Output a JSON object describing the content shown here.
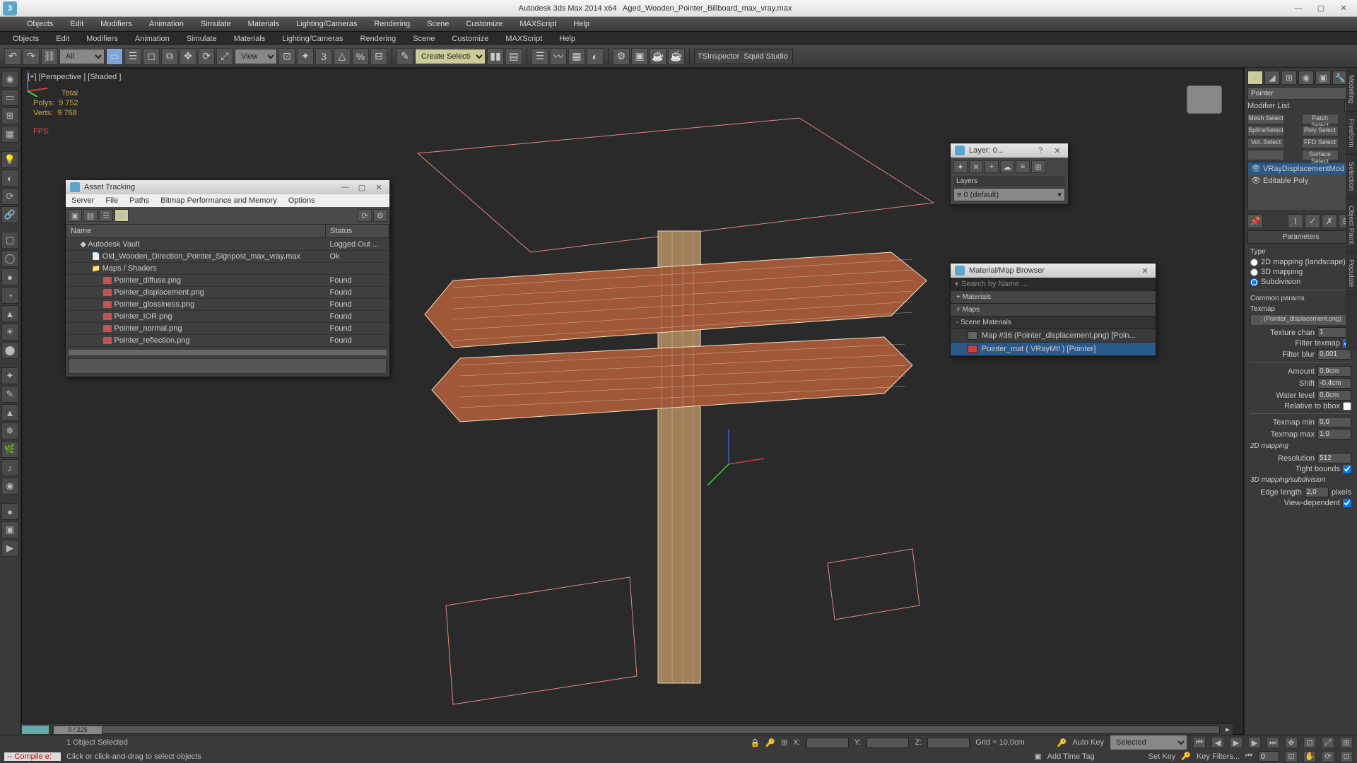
{
  "titlebar": {
    "app": "Autodesk 3ds Max  2014 x64",
    "file": "Aged_Wooden_Pointer_Billboard_max_vray.max"
  },
  "menus1": [
    "Objects",
    "Edit",
    "Modifiers",
    "Animation",
    "Simulate",
    "Materials",
    "Lighting/Cameras",
    "Rendering",
    "Scene",
    "Customize",
    "MAXScript",
    "Help"
  ],
  "menus2": [
    "Objects",
    "Edit",
    "Modifiers",
    "Animation",
    "Simulate",
    "Materials",
    "Lighting/Cameras",
    "Rendering",
    "Scene",
    "Customize",
    "MAXScript",
    "Help"
  ],
  "toolbar": {
    "combo_all": "All",
    "combo_view": "View",
    "combo_sel": "Create Selection Se",
    "text": "TSInspector  Squid Studio v"
  },
  "viewport": {
    "label": "[+] [Perspective ] [Shaded ]",
    "stats": {
      "total": "Total",
      "polys_l": "Polys:",
      "polys_v": "9 752",
      "verts_l": "Verts:",
      "verts_v": "9 768",
      "fps": "FPS:"
    }
  },
  "asset": {
    "title": "Asset Tracking",
    "submenu": [
      "Server",
      "File",
      "Paths",
      "Bitmap Performance and Memory",
      "Options"
    ],
    "cols": {
      "name": "Name",
      "status": "Status"
    },
    "rows": [
      {
        "n": "Autodesk Vault",
        "s": "Logged Out ...",
        "lvl": 1,
        "icon": "vault"
      },
      {
        "n": "Old_Wooden_Direction_Pointer_Signpost_max_vray.max",
        "s": "Ok",
        "lvl": 2,
        "icon": "file"
      },
      {
        "n": "Maps / Shaders",
        "s": "",
        "lvl": 2,
        "icon": "folder"
      },
      {
        "n": "Pointer_diffuse.png",
        "s": "Found",
        "lvl": 3,
        "icon": "img"
      },
      {
        "n": "Pointer_displacement.png",
        "s": "Found",
        "lvl": 3,
        "icon": "img"
      },
      {
        "n": "Pointer_glossiness.png",
        "s": "Found",
        "lvl": 3,
        "icon": "img"
      },
      {
        "n": "Pointer_IOR.png",
        "s": "Found",
        "lvl": 3,
        "icon": "img"
      },
      {
        "n": "Pointer_normal.png",
        "s": "Found",
        "lvl": 3,
        "icon": "img"
      },
      {
        "n": "Pointer_reflection.png",
        "s": "Found",
        "lvl": 3,
        "icon": "img"
      }
    ]
  },
  "layers": {
    "title": "Layer: 0...",
    "hdr": "Layers",
    "default": "0 (default)"
  },
  "mat": {
    "title": "Material/Map Browser",
    "search": "Search by Name ...",
    "cats": {
      "materials": "+ Materials",
      "maps": "+ Maps",
      "scene": "- Scene Materials"
    },
    "items": [
      {
        "label": "Map #36 (Pointer_displacement.png)  [Poin...",
        "sel": false
      },
      {
        "label": "Pointer_mat  ( VRayMtl )  [Pointer]",
        "sel": true,
        "red": true
      }
    ]
  },
  "cmd": {
    "objname": "Pointer",
    "modlabel": "Modifier List",
    "modbtns": [
      "Mesh Select",
      "Patch Select",
      "SplineSelect",
      "Poly Select",
      "Vol. Select",
      "FFD Select",
      "",
      "Surface Select"
    ],
    "stack": [
      {
        "t": "VRayDisplacementMod",
        "sel": true
      },
      {
        "t": "Editable Poly",
        "sel": false
      }
    ],
    "params_hdr": "Parameters",
    "type_hdr": "Type",
    "types": [
      "2D mapping (landscape)",
      "3D mapping",
      "Subdivision"
    ],
    "common_hdr": "Common params",
    "texmap_hdr": "Texmap",
    "texmap_btn": ": (Pointer_displacement.png)",
    "fields": {
      "texchan_l": "Texture chan",
      "texchan": "1",
      "filtex_l": "Filter texmap",
      "filblur_l": "Filter blur",
      "filblur": "0,001",
      "amount_l": "Amount",
      "amount": "0,9cm",
      "shift_l": "Shift",
      "shift": "-0,4cm",
      "water_l": "Water level",
      "water": "0,0cm",
      "relbbox_l": "Relative to bbox",
      "tmin_l": "Texmap min",
      "tmin": "0,0",
      "tmax_l": "Texmap max",
      "tmax": "1,0",
      "map2d_hdr": "2D mapping",
      "res_l": "Resolution",
      "res": "512",
      "tight_l": "Tight bounds",
      "map3d_hdr": "3D mapping/subdivision",
      "edge_l": "Edge length",
      "edge": "2,0",
      "pixels": "pixels",
      "viewdep_l": "View-dependent"
    }
  },
  "timeline": {
    "frame": "0 / 225"
  },
  "status": {
    "selected": "1 Object Selected",
    "x": "X:",
    "y": "Y:",
    "z": "Z:",
    "grid": "Grid = 10,0cm",
    "autokey": "Auto Key",
    "selected_combo": "Selected",
    "setkey": "Set Key",
    "keyfilters": "Key Filters...",
    "addtag": "Add Time Tag",
    "compile": "-- Compile e:",
    "hint": "Click or click-and-drag to select objects"
  }
}
